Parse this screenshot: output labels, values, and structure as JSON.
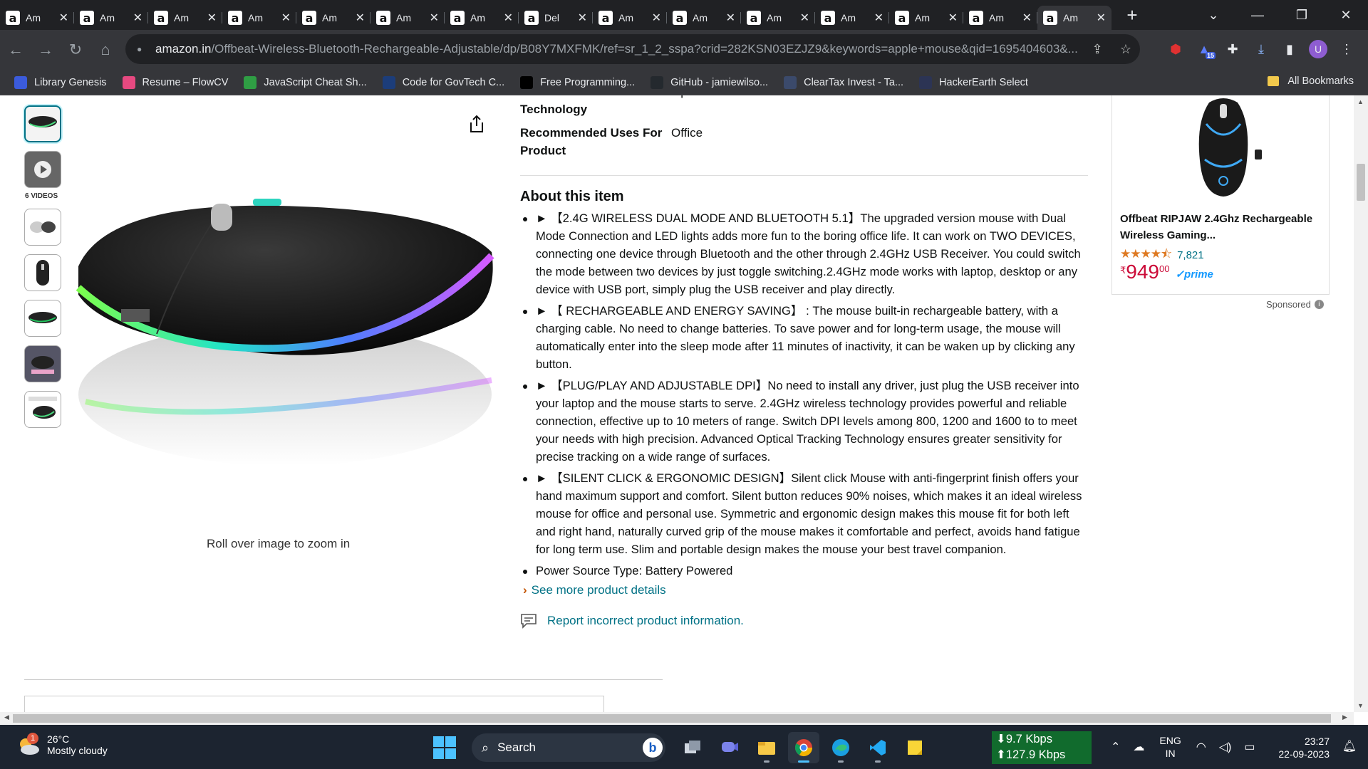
{
  "browser": {
    "tabs": [
      {
        "label": "Am",
        "active": false
      },
      {
        "label": "Am",
        "active": false
      },
      {
        "label": "Am",
        "active": false
      },
      {
        "label": "Am",
        "active": false
      },
      {
        "label": "Am",
        "active": false
      },
      {
        "label": "Am",
        "active": false
      },
      {
        "label": "Am",
        "active": false
      },
      {
        "label": "Del",
        "active": false
      },
      {
        "label": "Am",
        "active": false
      },
      {
        "label": "Am",
        "active": false
      },
      {
        "label": "Am",
        "active": false
      },
      {
        "label": "Am",
        "active": false
      },
      {
        "label": "Am",
        "active": false
      },
      {
        "label": "Am",
        "active": false
      },
      {
        "label": "Am",
        "active": true
      }
    ],
    "new_tab": "+",
    "url_host": "amazon.in",
    "url_path": "/Offbeat-Wireless-Bluetooth-Rechargeable-Adjustable/dp/B08Y7MXFMK/ref=sr_1_2_sspa?crid=282KSN03EZJZ9&keywords=apple+mouse&qid=1695404603&...",
    "profile_initial": "U",
    "extension_badge": "15",
    "bookmarks": [
      {
        "label": "Library Genesis",
        "icon": "libgen-icon",
        "color": "#3b5bdb"
      },
      {
        "label": "Resume – FlowCV",
        "icon": "flowcv-icon",
        "color": "#e64980"
      },
      {
        "label": "JavaScript Cheat Sh...",
        "icon": "js-icon",
        "color": "#2f9e44"
      },
      {
        "label": "Code for GovTech C...",
        "icon": "un-icon",
        "color": "#1c3d7a"
      },
      {
        "label": "Free Programming...",
        "icon": "freeprog-icon",
        "color": "#000000"
      },
      {
        "label": "GitHub - jamiewilso...",
        "icon": "github-icon",
        "color": "#24292e"
      },
      {
        "label": "ClearTax Invest - Ta...",
        "icon": "cleartax-icon",
        "color": "#3b4a6b"
      },
      {
        "label": "HackerEarth Select",
        "icon": "hackerearth-icon",
        "color": "#2c3454"
      }
    ],
    "all_bookmarks": "All Bookmarks"
  },
  "product": {
    "videos_label": "6 VIDEOS",
    "zoom_hint": "Roll over image to zoom in",
    "specs": [
      {
        "key": "Movement Detection Technology",
        "value": "Optical"
      },
      {
        "key": "Recommended Uses For Product",
        "value": "Office"
      }
    ],
    "about_heading": "About this item",
    "bullets": [
      "► 【2.4G WIRELESS DUAL MODE AND BLUETOOTH 5.1】The upgraded version mouse with Dual Mode Connection and LED lights adds more fun to the boring office life. It can work on TWO DEVICES, connecting one device through Bluetooth and the other through 2.4GHz USB Receiver. You could switch the mode between two devices by just toggle switching.2.4GHz mode works with laptop, desktop or any device with USB port, simply plug the USB receiver and play directly.",
      "► 【 RECHARGEABLE AND ENERGY SAVING】 : The mouse built-in rechargeable battery, with a charging cable. No need to change batteries. To save power and for long-term usage, the mouse will automatically enter into the sleep mode after 11 minutes of inactivity, it can be waken up by clicking any button.",
      "► 【PLUG/PLAY AND ADJUSTABLE DPI】No need to install any driver, just plug the USB receiver into your laptop and the mouse starts to serve. 2.4GHz wireless technology provides powerful and reliable connection, effective up to 10 meters of range. Switch DPI levels among 800, 1200 and 1600 to to meet your needs with high precision. Advanced Optical Tracking Technology ensures greater sensitivity for precise tracking on a wide range of surfaces.",
      "► 【SILENT CLICK & ERGONOMIC DESIGN】Silent click Mouse with anti-fingerprint finish offers your hand maximum support and comfort. Silent button reduces 90% noises, which makes it an ideal wireless mouse for office and personal use. Symmetric and ergonomic design makes this mouse fit for both left and right hand, naturally curved grip of the mouse makes it comfortable and perfect, avoids hand fatigue for long term use. Slim and portable design makes the mouse your best travel companion.",
      "Power Source Type: Battery Powered"
    ],
    "see_more": "See more product details",
    "report": "Report incorrect product information."
  },
  "sponsored": {
    "title": "Offbeat RIPJAW 2.4Ghz Rechargeable Wireless Gaming...",
    "rating": 4.5,
    "rating_count": "7,821",
    "currency": "₹",
    "price_whole": "949",
    "price_fraction": "00",
    "prime": "✓prime",
    "label": "Sponsored"
  },
  "taskbar": {
    "weather_temp": "26°C",
    "weather_desc": "Mostly cloudy",
    "weather_badge": "1",
    "search_label": "Search",
    "net_down": "⬇9.7 Kbps",
    "net_up": "⬆127.9 Kbps",
    "lang_line1": "ENG",
    "lang_line2": "IN",
    "time": "23:27",
    "date": "22-09-2023"
  }
}
